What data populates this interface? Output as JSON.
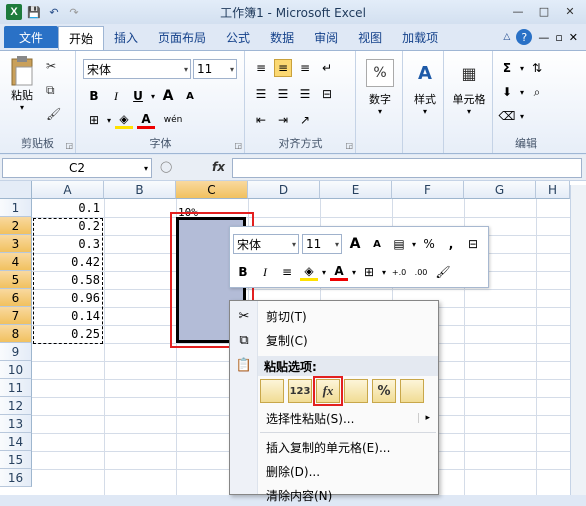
{
  "window": {
    "title": "工作簿1 - Microsoft Excel"
  },
  "qat": {
    "save": "💾",
    "undo": "↶",
    "redo": "↷"
  },
  "tabs": {
    "file": "文件",
    "items": [
      "开始",
      "插入",
      "页面布局",
      "公式",
      "数据",
      "审阅",
      "视图",
      "加载项"
    ]
  },
  "ribbon": {
    "clipboard": {
      "label": "剪贴板",
      "paste": "粘贴"
    },
    "font": {
      "label": "字体",
      "name": "宋体",
      "size": "11",
      "bold": "B",
      "italic": "I",
      "underline": "U",
      "grow": "A",
      "shrink": "A",
      "wen": "wén"
    },
    "align": {
      "label": "对齐方式"
    },
    "number": {
      "label": "数字",
      "icon": "%"
    },
    "style": {
      "label": "样式"
    },
    "cells": {
      "label": "单元格"
    },
    "edit": {
      "label": "编辑",
      "sum": "Σ"
    }
  },
  "formula": {
    "namebox": "C2",
    "fx": "fx",
    "value": ""
  },
  "grid": {
    "columns": [
      "A",
      "B",
      "C",
      "D",
      "E",
      "F",
      "G",
      "H"
    ],
    "rows": [
      "1",
      "2",
      "3",
      "4",
      "5",
      "6",
      "7",
      "8",
      "9",
      "10",
      "11",
      "12",
      "13",
      "14",
      "15",
      "16"
    ],
    "a_values": [
      "0.1",
      "0.2",
      "0.3",
      "0.42",
      "0.58",
      "0.96",
      "0.14",
      "0.25"
    ],
    "c1": "10%"
  },
  "minitoolbar": {
    "font": "宋体",
    "size": "11",
    "percent": "%",
    "comma": ",",
    "bold": "B",
    "italic": "I",
    "inc_dec": ".0\n.00",
    "dec_dec": ".00\n.0"
  },
  "contextmenu": {
    "cut": "剪切(T)",
    "copy": "复制(C)",
    "paste_options": "粘贴选项:",
    "paste_icons": [
      "",
      "123",
      "fx",
      "",
      "%",
      ""
    ],
    "paste_special": "选择性粘贴(S)...",
    "insert_copied": "插入复制的单元格(E)...",
    "delete": "删除(D)...",
    "clear": "清除内容(N)"
  },
  "colors": {
    "accent": "#2a71c6",
    "selection": "#b3bcd7",
    "highlight": "#e32020"
  }
}
